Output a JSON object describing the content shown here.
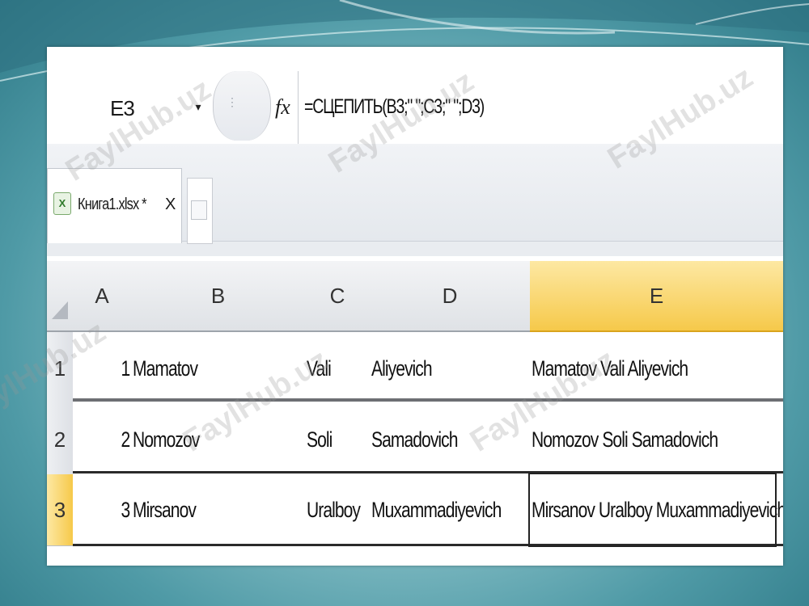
{
  "formula_bar": {
    "name_box": "E3",
    "dropdown_glyph": "▾",
    "fx_label": "fx",
    "formula": "=СЦЕПИТЬ(B3;\" \";C3;\" \";D3)"
  },
  "tabs": [
    {
      "label": "Книга1.xlsx *",
      "close": "X",
      "icon": "excel-file-icon"
    }
  ],
  "columns": [
    "A",
    "B",
    "C",
    "D",
    "E"
  ],
  "active_column": "E",
  "active_row": "3",
  "rows": [
    {
      "header": "1",
      "A": "1",
      "B": "Mamatov",
      "C": "Vali",
      "D": "Aliyevich",
      "E": "Mamatov Vali Aliyevich"
    },
    {
      "header": "2",
      "A": "2",
      "B": "Nomozov",
      "C": "Soli",
      "D": "Samadovich",
      "E": "Nomozov Soli Samadovich"
    },
    {
      "header": "3",
      "A": "3",
      "B": "Mirsanov",
      "C": "Uralboy",
      "D": "Muxammadiyevich",
      "E": "Mirsanov Uralboy Muxammadiyevich"
    }
  ],
  "watermark": "FaylHub.uz",
  "colors": {
    "active_header": "#f6c94a",
    "background": "#4f9aa6"
  }
}
